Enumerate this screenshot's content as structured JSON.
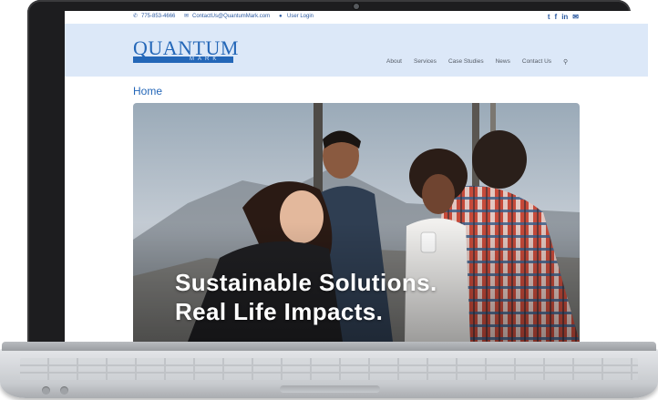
{
  "topbar": {
    "phone": "775-853-4666",
    "email": "ContactUs@QuantumMark.com",
    "login": "User Login",
    "social_icons": [
      "twitter-icon",
      "facebook-icon",
      "linkedin-icon",
      "mail-icon"
    ]
  },
  "brand": {
    "name": "QUANTUM",
    "sub": "MARK",
    "color": "#2467b8"
  },
  "nav": {
    "items": [
      "About",
      "Services",
      "Case Studies",
      "News",
      "Contact Us"
    ],
    "search_icon": "search-icon"
  },
  "page": {
    "heading": "Home"
  },
  "hero": {
    "line1": "Sustainable Solutions.",
    "line2": "Real Life Impacts."
  },
  "colors": {
    "header_bg": "#dce8f8",
    "accent": "#2467b8",
    "laptop_bezel": "#1d1d1f"
  }
}
